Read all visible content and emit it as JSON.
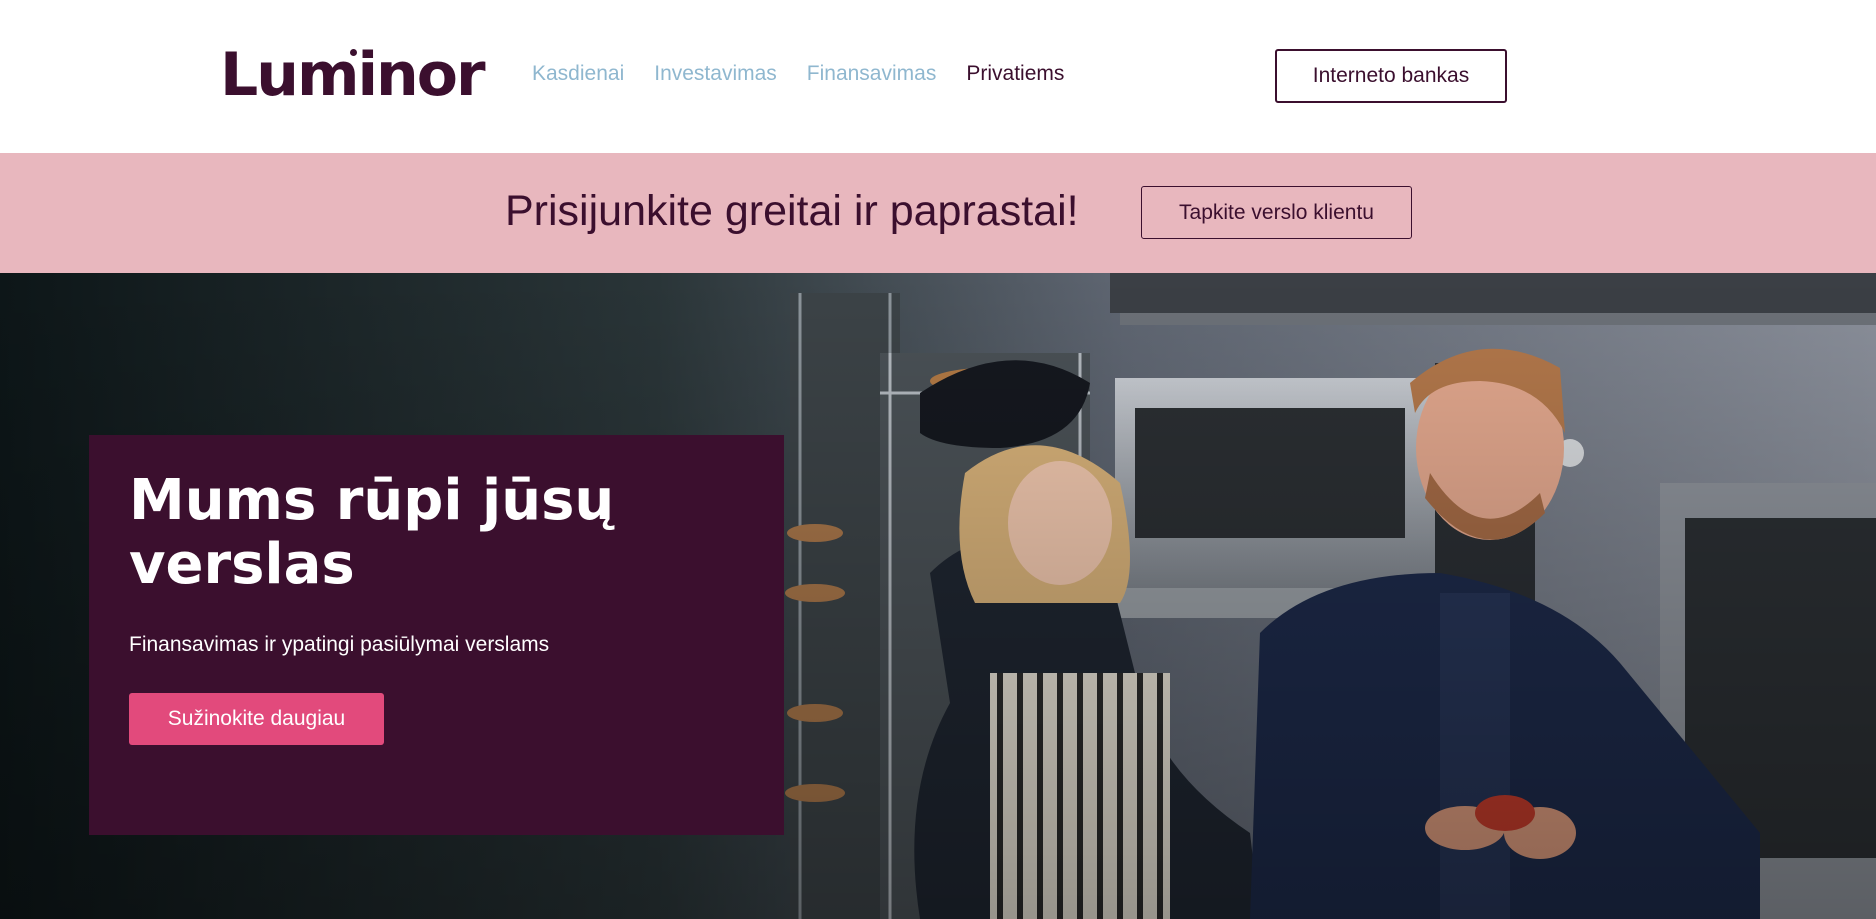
{
  "header": {
    "logo_text": "Luminor",
    "nav": [
      {
        "label": "Kasdienai",
        "active": false
      },
      {
        "label": "Investavimas",
        "active": false
      },
      {
        "label": "Finansavimas",
        "active": false
      },
      {
        "label": "Privatiems",
        "active": true
      }
    ],
    "netbank_label": "Interneto bankas"
  },
  "band": {
    "title": "Prisijunkite greitai ir paprastai!",
    "button_label": "Tapkite verslo klientu"
  },
  "hero": {
    "title": "Mums rūpi jūsų verslas",
    "subtitle": "Finansavimas ir ypatingi pasiūlymai verslams",
    "button_label": "Sužinokite daugiau"
  },
  "colors": {
    "brand": "#3b0f2e",
    "nav_link": "#8fb7cf",
    "band_bg": "#e8b7be",
    "cta": "#e24a7c"
  }
}
